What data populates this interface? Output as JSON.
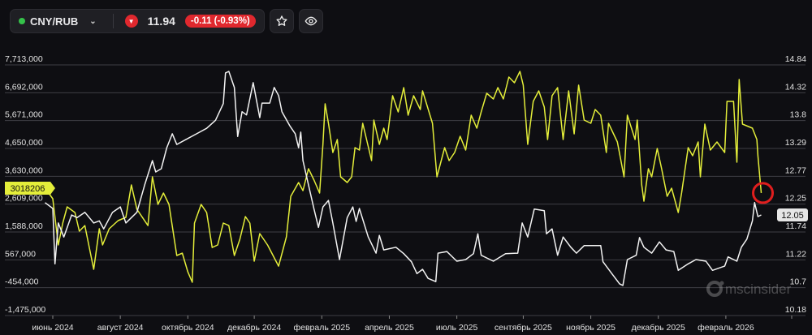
{
  "header": {
    "pair": "CNY/RUB",
    "price": "11.94",
    "change": "-0.11 (-0.93%)",
    "status_color": "#35c24a",
    "down_color": "#e0282e",
    "icons": [
      "chevron-down-icon",
      "down-arrow-icon",
      "star-icon",
      "eye-icon"
    ]
  },
  "watermark": "mscinsider",
  "chart_data": {
    "type": "line",
    "title": "CNY/RUB",
    "x_unit": "days since июнь 2024 tick",
    "xlim": [
      -7,
      648
    ],
    "x_ticks": [
      {
        "day": 0,
        "label": "июнь 2024"
      },
      {
        "day": 61,
        "label": "август 2024"
      },
      {
        "day": 122,
        "label": "октябрь 2024"
      },
      {
        "day": 182,
        "label": "декабрь 2024"
      },
      {
        "day": 243,
        "label": "февраль 2025"
      },
      {
        "day": 304,
        "label": "апрель 2025"
      },
      {
        "day": 365,
        "label": "июль 2025"
      },
      {
        "day": 425,
        "label": "сентябрь 2025"
      },
      {
        "day": 486,
        "label": "ноябрь 2025"
      },
      {
        "day": 547,
        "label": "декабрь 2025"
      },
      {
        "day": 608,
        "label": "февраль 2026"
      }
    ],
    "left_axis": {
      "ylim": [
        -1475000,
        7713000
      ],
      "ticks": [
        7713000,
        6692000,
        5671000,
        4650000,
        3630000,
        2609000,
        1588000,
        567000,
        -454000,
        -1475000
      ],
      "tick_labels": [
        "7,713,000",
        "6,692,000",
        "5,671,000",
        "4,650,000",
        "3,630,000",
        "2,609,000",
        "1,588,000",
        "567,000",
        "-454,000",
        "-1,475,000"
      ]
    },
    "right_axis": {
      "ylim": [
        10.18,
        14.84
      ],
      "ticks": [
        14.84,
        14.32,
        13.8,
        13.29,
        12.77,
        12.25,
        11.74,
        11.22,
        10.7,
        10.18
      ],
      "tick_labels": [
        "14.84",
        "14.32",
        "13.8",
        "13.29",
        "12.77",
        "12.25",
        "11.74",
        "11.22",
        "10.7",
        "10.18"
      ]
    },
    "grid": true,
    "series": [
      {
        "name": "yellow-left-axis",
        "axis": "left",
        "color": "#e4ee3a",
        "last_label": "3018206",
        "value_unit_multiplier": 1000,
        "points": [
          [
            -7,
            3193
          ],
          [
            0,
            2806
          ],
          [
            5,
            1111
          ],
          [
            9,
            1914
          ],
          [
            13,
            2508
          ],
          [
            20,
            2300
          ],
          [
            24,
            1616
          ],
          [
            29,
            1824
          ],
          [
            37,
            219
          ],
          [
            42,
            1706
          ],
          [
            45,
            1111
          ],
          [
            51,
            1706
          ],
          [
            59,
            2003
          ],
          [
            66,
            2122
          ],
          [
            71,
            3311
          ],
          [
            76,
            2419
          ],
          [
            86,
            1824
          ],
          [
            90,
            3609
          ],
          [
            95,
            2598
          ],
          [
            100,
            3014
          ],
          [
            105,
            2598
          ],
          [
            112,
            724
          ],
          [
            117,
            813
          ],
          [
            122,
            129
          ],
          [
            126,
            -257
          ],
          [
            128,
            1914
          ],
          [
            134,
            2598
          ],
          [
            139,
            2300
          ],
          [
            144,
            1021
          ],
          [
            149,
            1111
          ],
          [
            154,
            1914
          ],
          [
            159,
            1824
          ],
          [
            164,
            724
          ],
          [
            169,
            1319
          ],
          [
            174,
            2152
          ],
          [
            178,
            1914
          ],
          [
            182,
            516
          ],
          [
            187,
            1527
          ],
          [
            194,
            1111
          ],
          [
            204,
            337
          ],
          [
            211,
            1408
          ],
          [
            215,
            2895
          ],
          [
            222,
            3401
          ],
          [
            226,
            3103
          ],
          [
            231,
            3906
          ],
          [
            236,
            3490
          ],
          [
            241,
            3014
          ],
          [
            244,
            4798
          ],
          [
            246,
            6285
          ],
          [
            249,
            5572
          ],
          [
            253,
            4501
          ],
          [
            257,
            4977
          ],
          [
            260,
            3609
          ],
          [
            266,
            3401
          ],
          [
            270,
            3609
          ],
          [
            273,
            4680
          ],
          [
            277,
            4590
          ],
          [
            280,
            5572
          ],
          [
            288,
            4204
          ],
          [
            290,
            5691
          ],
          [
            295,
            4798
          ],
          [
            299,
            5393
          ],
          [
            302,
            4977
          ],
          [
            307,
            6583
          ],
          [
            312,
            5988
          ],
          [
            317,
            6880
          ],
          [
            321,
            5869
          ],
          [
            326,
            6583
          ],
          [
            332,
            6077
          ],
          [
            334,
            6761
          ],
          [
            343,
            5572
          ],
          [
            347,
            3609
          ],
          [
            354,
            4680
          ],
          [
            358,
            4204
          ],
          [
            363,
            4501
          ],
          [
            368,
            5096
          ],
          [
            373,
            4590
          ],
          [
            378,
            5869
          ],
          [
            383,
            5393
          ],
          [
            387,
            5988
          ],
          [
            392,
            6672
          ],
          [
            398,
            6464
          ],
          [
            402,
            6880
          ],
          [
            407,
            6464
          ],
          [
            412,
            7267
          ],
          [
            417,
            7059
          ],
          [
            422,
            7475
          ],
          [
            425,
            6969
          ],
          [
            429,
            4798
          ],
          [
            434,
            6375
          ],
          [
            439,
            6761
          ],
          [
            444,
            6167
          ],
          [
            447,
            4977
          ],
          [
            451,
            6583
          ],
          [
            456,
            6880
          ],
          [
            461,
            4977
          ],
          [
            466,
            6761
          ],
          [
            471,
            5185
          ],
          [
            475,
            6969
          ],
          [
            480,
            5691
          ],
          [
            486,
            5572
          ],
          [
            490,
            6077
          ],
          [
            495,
            5869
          ],
          [
            500,
            4501
          ],
          [
            502,
            5572
          ],
          [
            510,
            4888
          ],
          [
            516,
            3609
          ],
          [
            519,
            5869
          ],
          [
            526,
            4977
          ],
          [
            528,
            5691
          ],
          [
            532,
            3311
          ],
          [
            534,
            2717
          ],
          [
            538,
            3906
          ],
          [
            541,
            3609
          ],
          [
            546,
            4650
          ],
          [
            550,
            3906
          ],
          [
            555,
            2895
          ],
          [
            559,
            3193
          ],
          [
            565,
            2300
          ],
          [
            568,
            3014
          ],
          [
            574,
            4680
          ],
          [
            578,
            4382
          ],
          [
            583,
            4888
          ],
          [
            585,
            3609
          ],
          [
            589,
            5542
          ],
          [
            594,
            4590
          ],
          [
            600,
            4888
          ],
          [
            607,
            4501
          ],
          [
            609,
            6375
          ],
          [
            615,
            6375
          ],
          [
            618,
            4144
          ],
          [
            620,
            7178
          ],
          [
            623,
            5542
          ],
          [
            632,
            5393
          ],
          [
            636,
            4977
          ],
          [
            637,
            4382
          ],
          [
            640,
            3018
          ]
        ]
      },
      {
        "name": "white-right-axis",
        "axis": "right",
        "color": "#f2f2f2",
        "last_label": "12.05",
        "points": [
          [
            -7,
            12.28
          ],
          [
            0,
            12.17
          ],
          [
            2,
            11.14
          ],
          [
            5,
            11.9
          ],
          [
            10,
            11.64
          ],
          [
            17,
            12.05
          ],
          [
            22,
            12.0
          ],
          [
            29,
            12.1
          ],
          [
            37,
            11.9
          ],
          [
            42,
            11.94
          ],
          [
            46,
            11.79
          ],
          [
            54,
            12.1
          ],
          [
            61,
            12.2
          ],
          [
            66,
            11.9
          ],
          [
            76,
            12.1
          ],
          [
            83,
            12.61
          ],
          [
            90,
            13.06
          ],
          [
            93,
            12.85
          ],
          [
            98,
            12.91
          ],
          [
            103,
            13.3
          ],
          [
            108,
            13.56
          ],
          [
            112,
            13.36
          ],
          [
            120,
            13.45
          ],
          [
            130,
            13.56
          ],
          [
            139,
            13.66
          ],
          [
            147,
            13.81
          ],
          [
            154,
            14.12
          ],
          [
            156,
            14.69
          ],
          [
            159,
            14.72
          ],
          [
            164,
            14.42
          ],
          [
            167,
            13.51
          ],
          [
            171,
            13.97
          ],
          [
            175,
            13.91
          ],
          [
            181,
            14.51
          ],
          [
            187,
            13.86
          ],
          [
            189,
            14.13
          ],
          [
            196,
            14.13
          ],
          [
            200,
            14.42
          ],
          [
            204,
            14.27
          ],
          [
            207,
            13.97
          ],
          [
            214,
            13.71
          ],
          [
            219,
            13.56
          ],
          [
            222,
            13.3
          ],
          [
            224,
            13.59
          ],
          [
            226,
            13.06
          ],
          [
            231,
            12.61
          ],
          [
            236,
            12.16
          ],
          [
            240,
            11.82
          ],
          [
            244,
            12.2
          ],
          [
            249,
            12.32
          ],
          [
            253,
            11.9
          ],
          [
            259,
            11.22
          ],
          [
            266,
            12.0
          ],
          [
            271,
            12.2
          ],
          [
            274,
            11.93
          ],
          [
            277,
            12.17
          ],
          [
            285,
            11.64
          ],
          [
            292,
            11.34
          ],
          [
            295,
            11.67
          ],
          [
            299,
            11.4
          ],
          [
            310,
            11.45
          ],
          [
            317,
            11.33
          ],
          [
            324,
            11.18
          ],
          [
            329,
            10.96
          ],
          [
            334,
            11.04
          ],
          [
            339,
            10.87
          ],
          [
            346,
            10.81
          ],
          [
            348,
            11.34
          ],
          [
            356,
            11.37
          ],
          [
            365,
            11.19
          ],
          [
            373,
            11.22
          ],
          [
            380,
            11.33
          ],
          [
            384,
            11.7
          ],
          [
            387,
            11.3
          ],
          [
            398,
            11.19
          ],
          [
            409,
            11.33
          ],
          [
            420,
            11.34
          ],
          [
            424,
            11.9
          ],
          [
            429,
            11.64
          ],
          [
            435,
            12.16
          ],
          [
            444,
            12.13
          ],
          [
            446,
            11.7
          ],
          [
            451,
            11.79
          ],
          [
            456,
            11.3
          ],
          [
            461,
            11.64
          ],
          [
            468,
            11.45
          ],
          [
            473,
            11.34
          ],
          [
            480,
            11.48
          ],
          [
            495,
            11.48
          ],
          [
            497,
            11.18
          ],
          [
            505,
            10.96
          ],
          [
            512,
            10.77
          ],
          [
            515,
            10.74
          ],
          [
            519,
            11.22
          ],
          [
            527,
            11.3
          ],
          [
            530,
            11.63
          ],
          [
            534,
            11.45
          ],
          [
            541,
            11.34
          ],
          [
            548,
            11.55
          ],
          [
            554,
            11.4
          ],
          [
            561,
            11.37
          ],
          [
            565,
            11.02
          ],
          [
            574,
            11.14
          ],
          [
            581,
            11.22
          ],
          [
            590,
            11.19
          ],
          [
            596,
            11.02
          ],
          [
            607,
            11.1
          ],
          [
            610,
            11.27
          ],
          [
            618,
            11.19
          ],
          [
            622,
            11.45
          ],
          [
            627,
            11.6
          ],
          [
            632,
            11.94
          ],
          [
            634,
            12.28
          ],
          [
            637,
            12.02
          ],
          [
            640,
            12.05
          ]
        ]
      }
    ],
    "annotation": "red circle at latest yellow point"
  }
}
